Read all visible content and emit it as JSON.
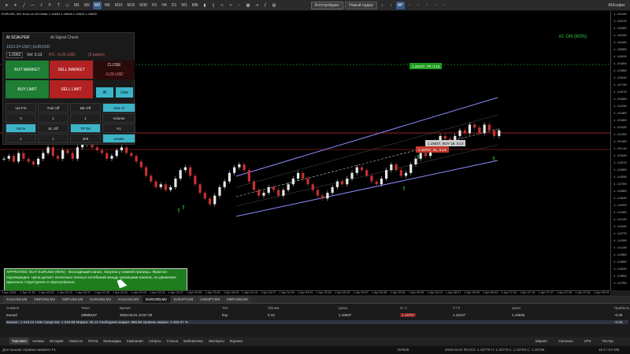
{
  "toolbar": {
    "timeframes": [
      "M1",
      "M2",
      "M3",
      "M5",
      "M10",
      "M15",
      "M30",
      "H1",
      "H4",
      "D1",
      "W1",
      "MN"
    ],
    "selected_timeframe": "M3",
    "algo_label": "Алготрейдинг",
    "new_order_label": "Новый ордер",
    "ap_label": "AP",
    "chart_name": "AIScalper"
  },
  "chart": {
    "symbol_title": "EURUSD, M3: Euro vs US Dollar 1.15634 1.15646 1.15623 1.15632",
    "ai_status": "AI: ON (60%)",
    "labels": {
      "tp": "1.16137, TP, 0.13",
      "buy": "1.15637, BUY 18, 0.13",
      "sl": "1.15757, SL, 0.13"
    },
    "price_ticks": [
      "1.16440",
      "1.16370",
      "1.16300",
      "1.16230",
      "1.16160",
      "1.16090",
      "1.16020",
      "1.15950",
      "1.15880",
      "1.15810",
      "1.15740",
      "1.15670",
      "1.15600",
      "1.15530",
      "1.15460",
      "1.15390",
      "1.15320",
      "1.15250",
      "1.15180",
      "1.15110",
      "1.15040",
      "1.14970",
      "1.14900",
      "1.14830",
      "1.14760",
      "1.14690",
      "1.14620",
      "1.14550",
      "1.14480",
      "1.14410",
      "1.14340",
      "1.14270",
      "1.14200",
      "1.14130",
      "1.14060",
      "1.13990",
      "1.13920",
      "1.13850",
      "1.13780"
    ],
    "time_ticks": [
      "1 Apr 2026",
      "1 Apr 01:51",
      "1 Apr 02:03",
      "1 Apr 02:15",
      "1 Apr 02:27",
      "1 Apr 02:39",
      "1 Apr 02:51",
      "1 Apr 03:03",
      "1 Apr 03:15",
      "1 Apr 03:27",
      "1 Apr 03:39",
      "1 Apr 03:51",
      "1 Apr 04:03",
      "1 Apr 04:15",
      "1 Apr 04:27",
      "1 Apr 04:39",
      "1 Apr 04:51",
      "1 Apr 05:03",
      "1 Apr 05:15",
      "1 Apr 05:27",
      "1 Apr 05:39",
      "1 Apr 05:51",
      "1 Apr 06:03",
      "1 Apr 06:15",
      "1 Apr 06:27",
      "1 Apr 06:39",
      "1 Apr 06:51",
      "1 Apr 07:03",
      "1 Apr 07:15",
      "1 Apr 07:27",
      "1 Apr 07:39",
      "1 Apr 07:51",
      "1 Apr 08:03"
    ],
    "signal_text": "APPROVED: BUY EURUSD (65%) - Восходящий канал, покупка у нижней границы. Фрактал подтвержден. Цена делает несколько полных колебаний между границами канала, но движение идеально структурное и нерегулярные."
  },
  "panel": {
    "title": "AI SCALPER",
    "signal_check": "AI Signal Check",
    "balance": "1019.24 USD | EURUSD",
    "lots": "1.0963",
    "vol": "Vol: 0.13",
    "pnl": "P/L: -0.26 USD",
    "points": "(3 points)",
    "buy_market": "BUY MARKET",
    "sell_market": "SELL MARKET",
    "close": "CLOSE",
    "close_value": "-0.26 USD",
    "buy_limit": "BUY LIMIT",
    "sell_limit": "SELL LIMIT",
    "ai_btn": "AI",
    "line_btn": "Line",
    "grid": [
      [
        "Vol FIX",
        "Trail Off",
        "BE Off",
        "VOL O"
      ],
      [
        "0",
        "1",
        "1",
        "Volume"
      ],
      [
        "Vol %",
        "SL Off",
        "TP On",
        "H1"
      ],
      [
        "1",
        "1",
        "300",
        "Levels"
      ]
    ]
  },
  "symbol_tabs": [
    "XAUUSD,M3",
    "GBPUSD,M3",
    "GBPUSD,M3",
    "EURUSD,M3",
    "XAUUSD,M3",
    "EURUSD,M3",
    "EURJPY,M3",
    "USDJPY,M3",
    "GBPUSD,M3"
  ],
  "active_symbol_tab": 5,
  "trade": {
    "headers": [
      "Символ",
      "Тикет",
      "Время",
      "Тип",
      "Объем",
      "Цена",
      "S / L",
      "T / P",
      "Цена",
      "Прибыль"
    ],
    "row": [
      "eurusd",
      "28586167",
      "2026.04.01 10:57:30",
      "buy",
      "0.13",
      "1.15637",
      "1.15757",
      "1.16137",
      "1.15635",
      "-0.26"
    ],
    "balance_line": "Баланс: 1 019.24 USD  Средства: 1 018.98  Маржа: 30.12  Свободная маржа: 988.86  Уровень маржи: 3 383.07 %",
    "balance_total": "-0.26"
  },
  "bottom_tabs": [
    "Торговля",
    "Активы",
    "История",
    "Новости",
    "Почта",
    "Календарь",
    "Компания",
    "Алерты",
    "Статьи",
    "Библиотека",
    "Эксперты",
    "Журнал"
  ],
  "status": {
    "help": "Для вызова справки нажмите F1",
    "profile": "Default",
    "datetime": "2026.04.01 09:21",
    "ohlc": "O: 1.15770  H: 1.15773  L: 1.15753  C: 1.15755",
    "right": "16.4 / 0.0 Mb",
    "market": "Маркет",
    "signals": "Сигналы",
    "vps": "VPS",
    "tester": "Тестер"
  },
  "chart_data": {
    "type": "candlestick",
    "series": [
      {
        "values": [
          1.1566,
          1.1567,
          1.1565,
          1.1568,
          1.1566,
          1.1565,
          1.1564,
          1.1566,
          1.1568,
          1.157,
          1.1567,
          1.1566,
          1.1569,
          1.1568,
          1.1566,
          1.157,
          1.1571,
          1.1572,
          1.157,
          1.1569,
          1.1568,
          1.1566,
          1.1567,
          1.1569,
          1.157,
          1.1568,
          1.1567,
          1.1565,
          1.1563,
          1.156,
          1.1558,
          1.1556,
          1.1557,
          1.1555,
          1.1556,
          1.1559,
          1.1562,
          1.1563,
          1.156,
          1.1557,
          1.1554,
          1.1552,
          1.155,
          1.1553,
          1.1556,
          1.1558,
          1.1561,
          1.1563,
          1.1564,
          1.1562,
          1.1558,
          1.1555,
          1.1553,
          1.1554,
          1.1556,
          1.1555,
          1.1553,
          1.1555,
          1.1557,
          1.1559,
          1.1561,
          1.1559,
          1.1557,
          1.1555,
          1.1553,
          1.1552,
          1.1554,
          1.1556,
          1.1558,
          1.1557,
          1.1559,
          1.1561,
          1.1563,
          1.1562,
          1.156,
          1.1558,
          1.1557,
          1.1559,
          1.1562,
          1.1564,
          1.1562,
          1.156,
          1.1561,
          1.1564,
          1.1566,
          1.1568,
          1.1567,
          1.1569,
          1.1572,
          1.1574,
          1.1573,
          1.1571,
          1.1574,
          1.1576,
          1.1575,
          1.1578,
          1.1577,
          1.1575,
          1.1578,
          1.1576,
          1.1574,
          1.1576
        ]
      }
    ]
  }
}
